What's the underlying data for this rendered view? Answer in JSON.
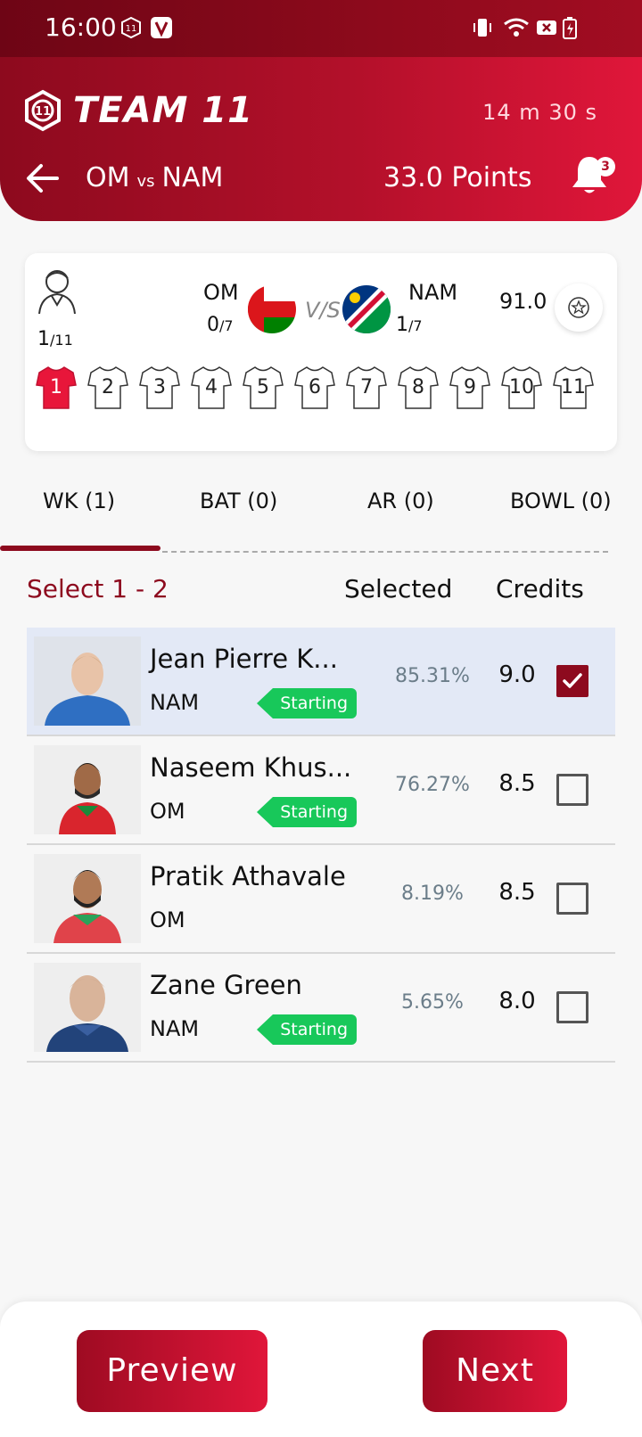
{
  "status_bar": {
    "time": "16:00"
  },
  "header": {
    "brand": "TEAM 11",
    "timer": "14 m  30 s",
    "team_a": "OM",
    "vs": "vs",
    "team_b": "NAM",
    "points": "33.0 Points",
    "notification_count": "3"
  },
  "team_card": {
    "players_selected": "1",
    "players_total": "/11",
    "team_a": {
      "name": "OM",
      "count": "0",
      "max": "/7"
    },
    "vs": "V/S",
    "team_b": {
      "name": "NAM",
      "count": "1",
      "max": "/7"
    },
    "credits_left": "91.0",
    "jerseys": [
      "1",
      "2",
      "3",
      "4",
      "5",
      "6",
      "7",
      "8",
      "9",
      "10",
      "11"
    ]
  },
  "tabs": [
    {
      "label": "WK (1)",
      "active": true
    },
    {
      "label": "BAT (0)",
      "active": false
    },
    {
      "label": "AR (0)",
      "active": false
    },
    {
      "label": "BOWL (0)",
      "active": false
    }
  ],
  "list_header": {
    "select_hint": "Select 1 - 2",
    "selected": "Selected",
    "credits": "Credits"
  },
  "players": [
    {
      "name": "Jean Pierre K...",
      "team": "NAM",
      "badge": "Starting",
      "selected_pct": "85.31%",
      "credits": "9.0",
      "checked": true
    },
    {
      "name": "Naseem Khus...",
      "team": "OM",
      "badge": "Starting",
      "selected_pct": "76.27%",
      "credits": "8.5",
      "checked": false
    },
    {
      "name": "Pratik Athavale",
      "team": "OM",
      "badge": "",
      "selected_pct": "8.19%",
      "credits": "8.5",
      "checked": false
    },
    {
      "name": "Zane Green",
      "team": "NAM",
      "badge": "Starting",
      "selected_pct": "5.65%",
      "credits": "8.0",
      "checked": false
    }
  ],
  "bottom": {
    "preview": "Preview",
    "next": "Next"
  },
  "colors": {
    "brand_dark": "#8d0a1e",
    "brand_light": "#e0163a",
    "starting_badge": "#18c85a"
  }
}
